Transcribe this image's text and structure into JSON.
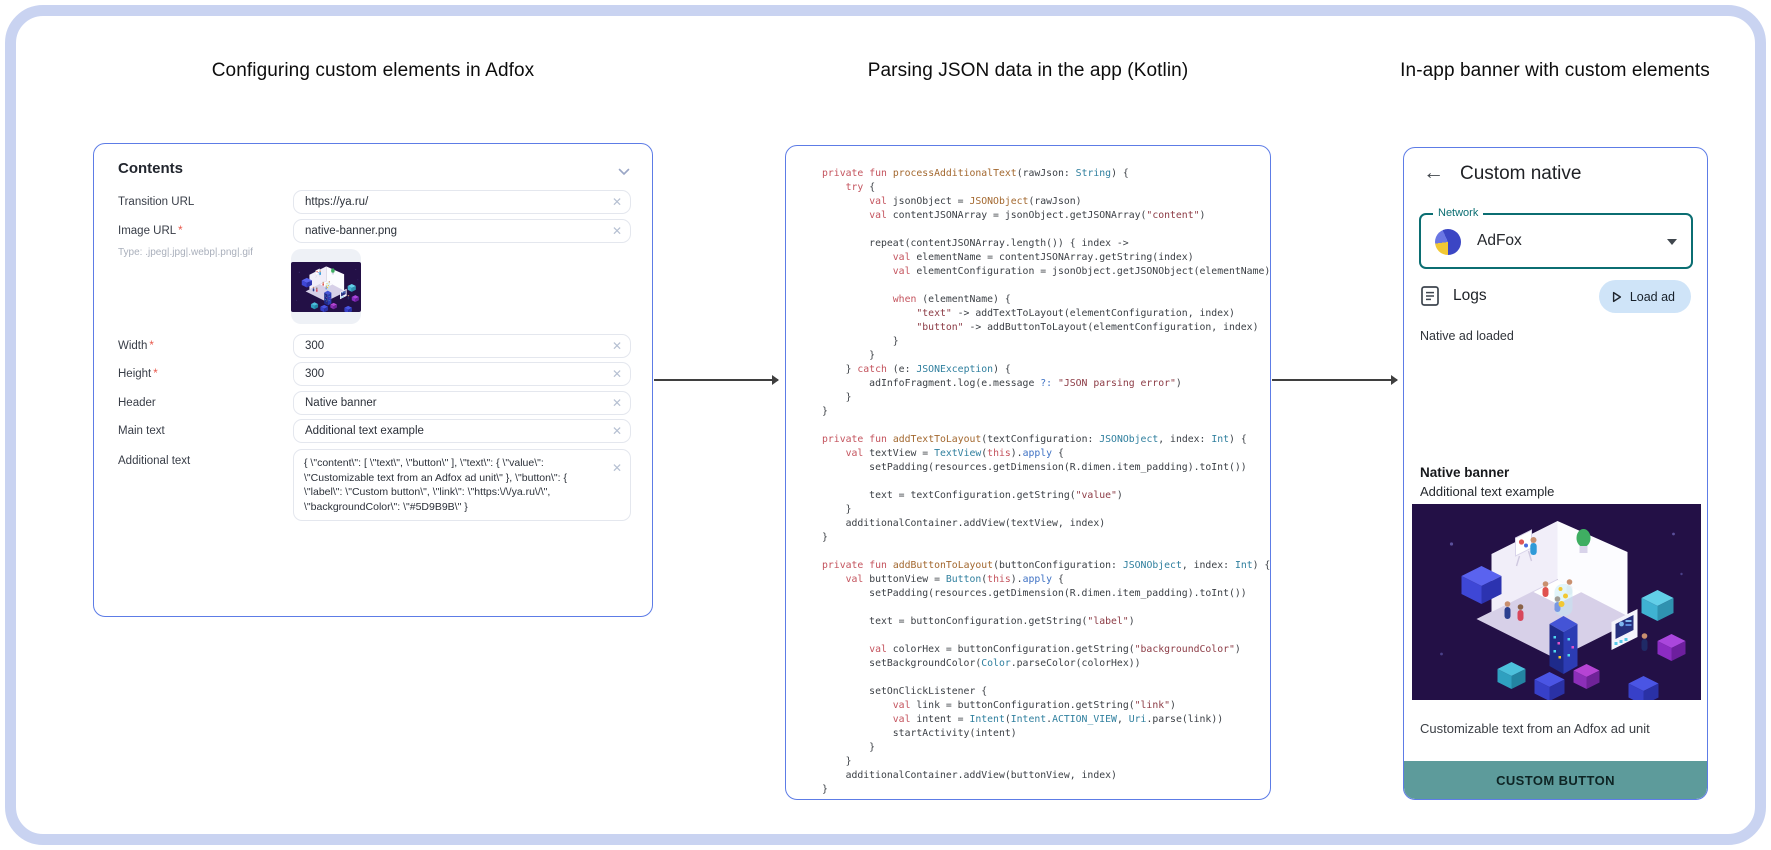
{
  "titles": {
    "left": "Configuring custom elements in Adfox",
    "middle": "Parsing JSON data in the app (Kotlin)",
    "right": "In-app banner with custom elements"
  },
  "colors": {
    "panel_border": "#5D7CE6",
    "frame_border": "#C9D3F1",
    "network_teal": "#0B6E72",
    "load_button_bg": "#CFE4F8",
    "custom_button_bg": "#5D9B9B"
  },
  "form": {
    "header": "Contents",
    "rows": [
      {
        "label": "Transition URL",
        "star": "",
        "value": "https://ya.ru/"
      },
      {
        "label": "Image URL",
        "star": "*",
        "value": "native-banner.png",
        "note": "Type: .jpeg|.jpg|.webp|.png|.gif"
      },
      {
        "label": "Width",
        "star": "*",
        "value": "300"
      },
      {
        "label": "Height",
        "star": "*",
        "value": "300"
      },
      {
        "label": "Header",
        "star": "",
        "value": "Native banner"
      },
      {
        "label": "Main text",
        "star": "",
        "value": "Additional text example"
      },
      {
        "label": "Additional text",
        "star": "",
        "value": "{  \\\"content\\\": [   \\\"text\\\",   \\\"button\\\"  ],  \\\"text\\\": {   \\\"value\\\": \\\"Customizable text from an Adfox ad unit\\\"  },  \\\"button\\\": {  \\\"label\\\": \\\"Custom button\\\",   \\\"link\\\": \\\"https:\\/\\/ya.ru\\/\\\",  \\\"backgroundColor\\\": \\\"#5D9B9B\\\"  }"
      }
    ],
    "clear_icon": "✕"
  },
  "code": {
    "lines": [
      "private fun processAdditionalText(rawJson: String) {",
      "    try {",
      "        val jsonObject = JSONObject(rawJson)",
      "        val contentJSONArray = jsonObject.getJSONArray(\"content\")",
      "",
      "        repeat(contentJSONArray.length()) { index ->",
      "            val elementName = contentJSONArray.getString(index)",
      "            val elementConfiguration = jsonObject.getJSONObject(elementName)",
      "",
      "            when (elementName) {",
      "                \"text\" -> addTextToLayout(elementConfiguration, index)",
      "                \"button\" -> addButtonToLayout(elementConfiguration, index)",
      "            }",
      "        }",
      "    } catch (e: JSONException) {",
      "        adInfoFragment.log(e.message ?: \"JSON parsing error\")",
      "    }",
      "}",
      "",
      "private fun addTextToLayout(textConfiguration: JSONObject, index: Int) {",
      "    val textView = TextView(this).apply {",
      "        setPadding(resources.getDimension(R.dimen.item_padding).toInt())",
      "",
      "        text = textConfiguration.getString(\"value\")",
      "    }",
      "    additionalContainer.addView(textView, index)",
      "}",
      "",
      "private fun addButtonToLayout(buttonConfiguration: JSONObject, index: Int) {",
      "    val buttonView = Button(this).apply {",
      "        setPadding(resources.getDimension(R.dimen.item_padding).toInt())",
      "",
      "        text = buttonConfiguration.getString(\"label\")",
      "",
      "        val colorHex = buttonConfiguration.getString(\"backgroundColor\")",
      "        setBackgroundColor(Color.parseColor(colorHex))",
      "",
      "        setOnClickListener {",
      "            val link = buttonConfiguration.getString(\"link\")",
      "            val intent = Intent(Intent.ACTION_VIEW, Uri.parse(link))",
      "            startActivity(intent)",
      "        }",
      "    }",
      "    additionalContainer.addView(buttonView, index)",
      "}"
    ]
  },
  "app": {
    "title": "Custom native",
    "back_icon": "←",
    "network_label": "Network",
    "network_value": "AdFox",
    "logs_label": "Logs",
    "load_ad_label": "Load ad",
    "log_line": "Native ad loaded",
    "banner": {
      "header": "Native banner",
      "main_text": "Additional text example",
      "additional_text": "Customizable text from an Adfox ad unit",
      "button_label": "CUSTOM BUTTON",
      "button_color": "#5D9B9B"
    }
  }
}
